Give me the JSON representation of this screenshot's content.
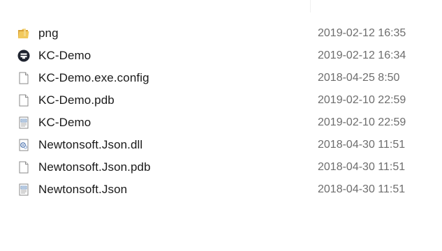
{
  "files": [
    {
      "name": "png",
      "modified": "2019-02-12 16:35",
      "icon": "folder-icon"
    },
    {
      "name": "KC-Demo",
      "modified": "2019-02-12 16:34",
      "icon": "app-exe-icon"
    },
    {
      "name": "KC-Demo.exe.config",
      "modified": "2018-04-25 8:50",
      "icon": "blank-file-icon"
    },
    {
      "name": "KC-Demo.pdb",
      "modified": "2019-02-10 22:59",
      "icon": "blank-file-icon"
    },
    {
      "name": "KC-Demo",
      "modified": "2019-02-10 22:59",
      "icon": "text-file-icon"
    },
    {
      "name": "Newtonsoft.Json.dll",
      "modified": "2018-04-30 11:51",
      "icon": "dll-file-icon"
    },
    {
      "name": "Newtonsoft.Json.pdb",
      "modified": "2018-04-30 11:51",
      "icon": "blank-file-icon"
    },
    {
      "name": "Newtonsoft.Json",
      "modified": "2018-04-30 11:51",
      "icon": "text-file-icon"
    }
  ],
  "colors": {
    "folder": "#e8b84a",
    "exe": "#1f2430",
    "date_text": "#6d6d6d",
    "name_text": "#1a1a1a"
  }
}
